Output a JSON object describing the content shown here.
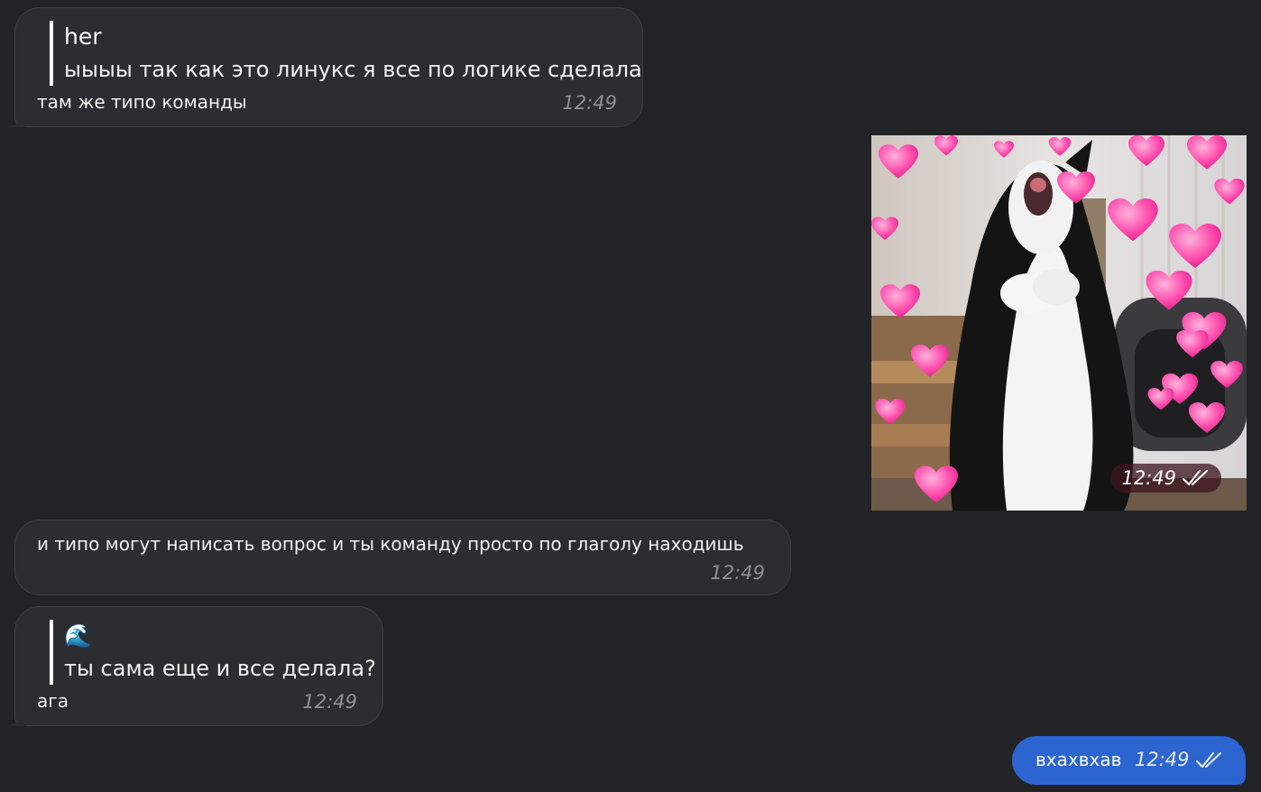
{
  "messages": [
    {
      "reply_author": "her",
      "reply_text": "ыыыы так как это линукс я все по логике сделала",
      "text": "там же типо команды",
      "time": "12:49"
    },
    {
      "photo_description": "cat-with-hearts-photo",
      "time": "12:49"
    },
    {
      "text": "и типо могут написать вопрос и ты команду просто по глаголу находишь",
      "time": "12:49"
    },
    {
      "reply_author": "🌊",
      "reply_text": "ты сама еще и все делала?",
      "text": "ага",
      "time": "12:49"
    },
    {
      "text": "вхахвхав",
      "time": "12:49"
    }
  ],
  "colors": {
    "background": "#212326",
    "incoming_bubble": "#2b2d31",
    "outgoing_bubble": "#2c65d0",
    "hearts": "#ff5fb4"
  }
}
